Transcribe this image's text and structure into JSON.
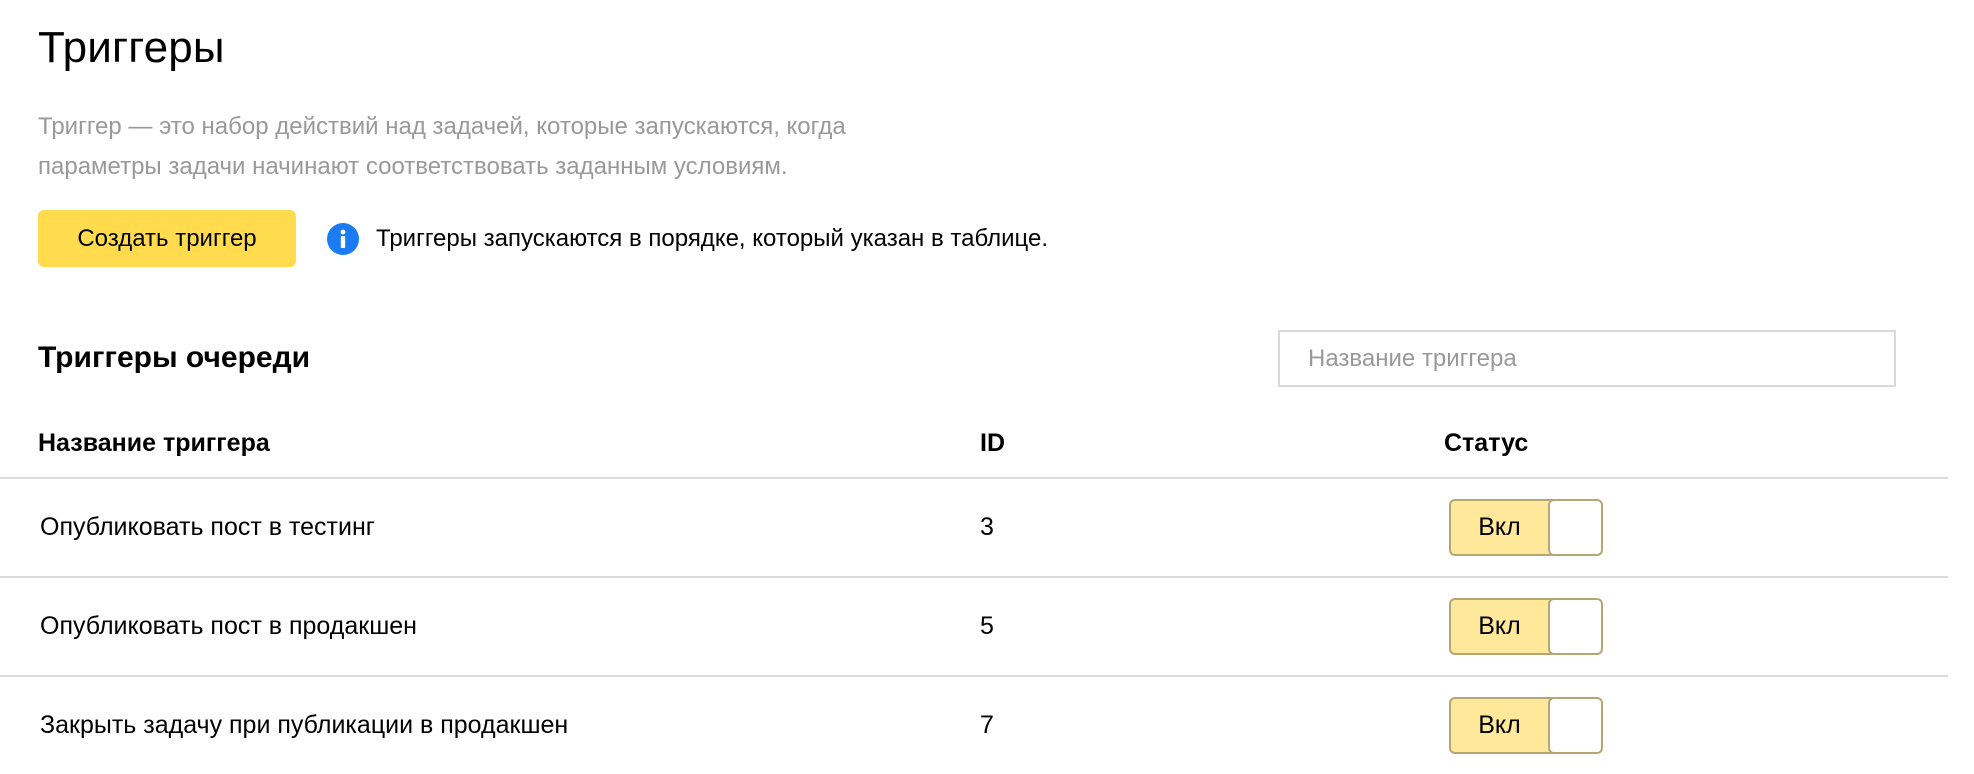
{
  "page": {
    "title": "Триггеры",
    "description_line1": "Триггер — это набор действий над задачей, которые запускаются, когда",
    "description_line2": "параметры задачи начинают соответствовать заданным условиям."
  },
  "toolbar": {
    "create_label": "Создать триггер",
    "info_icon": "info-icon",
    "info_text": "Триггеры запускаются в порядке, который указан в таблице."
  },
  "section": {
    "title": "Триггеры очереди",
    "search_placeholder": "Название триггера",
    "search_value": ""
  },
  "table": {
    "columns": [
      "Название триггера",
      "ID",
      "Статус"
    ],
    "rows": [
      {
        "name": "Опубликовать пост в тестинг",
        "id": "3",
        "status": "Вкл",
        "enabled": true
      },
      {
        "name": "Опубликовать пост в продакшен",
        "id": "5",
        "status": "Вкл",
        "enabled": true
      },
      {
        "name": "Закрыть задачу при публикации в продакшен",
        "id": "7",
        "status": "Вкл",
        "enabled": true
      }
    ]
  },
  "colors": {
    "accent_button": "#ffdb4d",
    "toggle_on": "#ffe899",
    "info_icon": "#1a7cf0",
    "muted_text": "#999999"
  }
}
